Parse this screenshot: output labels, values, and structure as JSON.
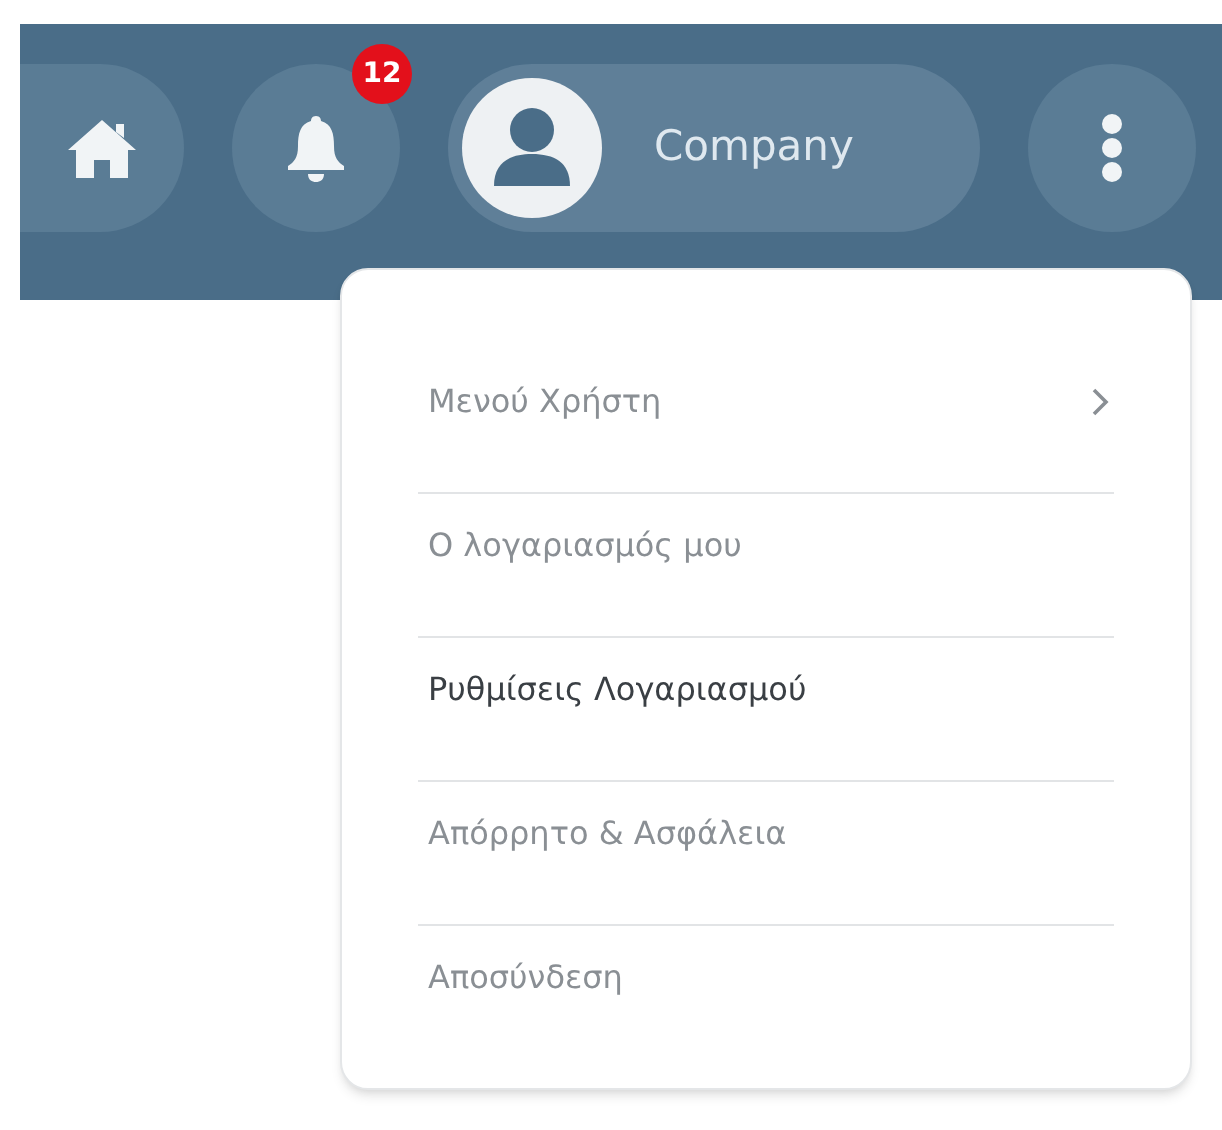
{
  "header": {
    "notifications": {
      "badge": "12"
    },
    "profile": {
      "name": "Company"
    }
  },
  "menu": {
    "items": [
      {
        "label": "Μενού Χρήστη",
        "kind": "submenu",
        "selected": false
      },
      {
        "label": "Ο λογαριασμός μου",
        "kind": "link",
        "selected": false
      },
      {
        "label": "Ρυθμίσεις Λογαριασμού",
        "kind": "link",
        "selected": true
      },
      {
        "label": "Απόρρητο & Ασφάλεια",
        "kind": "link",
        "selected": false
      },
      {
        "label": "Αποσύνδεση",
        "kind": "link",
        "selected": false
      }
    ]
  }
}
